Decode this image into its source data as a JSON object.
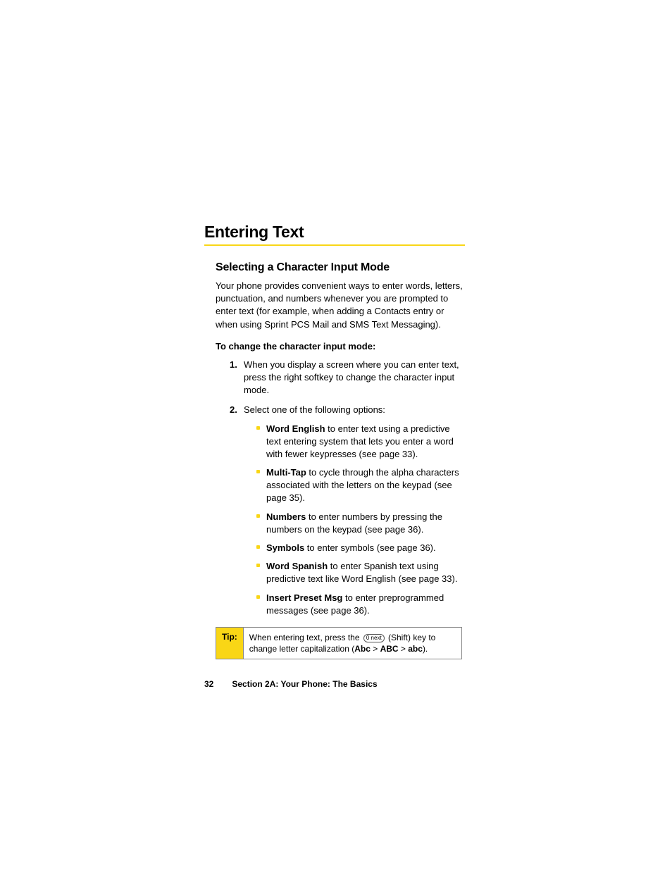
{
  "heading": "Entering Text",
  "subheading": "Selecting a Character Input Mode",
  "intro": "Your phone provides convenient ways to enter words, letters, punctuation, and numbers whenever you are prompted to enter text (for example, when adding a Contacts entry or when using Sprint PCS Mail and SMS Text Messaging).",
  "instruction_label": "To change the character input mode:",
  "steps": {
    "s1_num": "1.",
    "s1_text": "When you display a screen where you can enter text, press the right softkey to change the character input mode.",
    "s2_num": "2.",
    "s2_text": "Select one of the following options:"
  },
  "options": [
    {
      "bold": "Word English",
      "rest": " to enter text using a predictive text entering system that lets you enter a word with fewer keypresses (see page 33)."
    },
    {
      "bold": "Multi-Tap",
      "rest": " to cycle through the alpha characters associated with the letters on the keypad (see page 35)."
    },
    {
      "bold": "Numbers",
      "rest": " to enter numbers by pressing the numbers on the keypad (see page 36)."
    },
    {
      "bold": "Symbols",
      "rest": " to enter symbols (see page 36)."
    },
    {
      "bold": "Word Spanish",
      "rest": " to enter Spanish text using predictive text like Word English (see page 33)."
    },
    {
      "bold": "Insert Preset Msg",
      "rest": " to enter preprogrammed messages (see page 36)."
    }
  ],
  "tip": {
    "label": "Tip:",
    "pre": "When entering text, press the ",
    "key": "0 next",
    "mid": " (Shift) key to change letter capitalization (",
    "b1": "Abc",
    "sep1": " > ",
    "b2": "ABC",
    "sep2": " > ",
    "b3": "abc",
    "end": ")."
  },
  "footer": {
    "page_num": "32",
    "section": "Section 2A: Your Phone: The Basics"
  }
}
